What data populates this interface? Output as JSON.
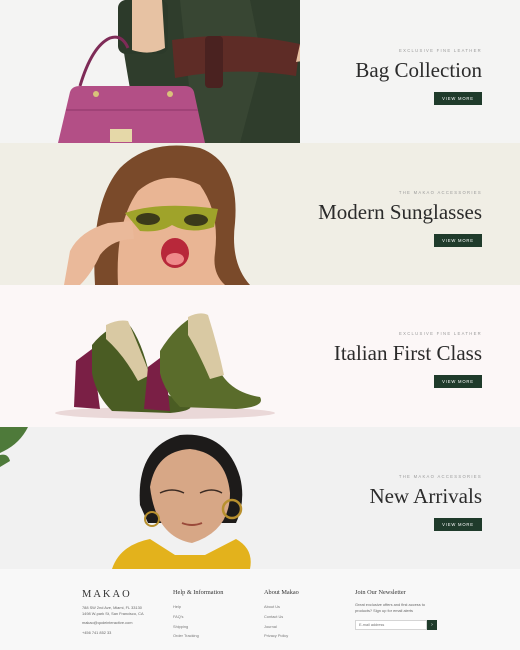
{
  "banners": [
    {
      "eyebrow": "Exclusive fine leather",
      "title": "Bag Collection",
      "button": "VIEW MORE"
    },
    {
      "eyebrow": "The Makao accessories",
      "title": "Modern Sunglasses",
      "button": "VIEW MORE"
    },
    {
      "eyebrow": "Exclusive fine leather",
      "title": "Italian First Class",
      "button": "VIEW MORE"
    },
    {
      "eyebrow": "The Makao accessories",
      "title": "New Arrivals",
      "button": "VIEW MORE"
    }
  ],
  "footer": {
    "logo": "MAKAO",
    "address_line1": "788 SW 2nd Ave, Miami, FL 33130",
    "address_line2": "1498 W-park St, San Francisco, CA",
    "email": "makao@qodeinteractive.com",
    "phone": "+456 741 852 33",
    "help": {
      "title": "Help & Information",
      "links": [
        "Help",
        "FAQ's",
        "Shipping",
        "Order Tracking"
      ]
    },
    "about": {
      "title": "About Makao",
      "links": [
        "About Us",
        "Contact Us",
        "Journal",
        "Privacy Policy"
      ]
    },
    "newsletter": {
      "title": "Join Our Newsletter",
      "text_line1": "Great exclusive offers and first access to",
      "text_line2": "products? Sign up for email alerts",
      "placeholder": "E-mail address",
      "button_icon": "arrow-right-icon"
    }
  },
  "colors": {
    "accent": "#1f3b2b",
    "bag": "#b34f86",
    "coat": "#2f3d2c",
    "belt": "#5e2c26",
    "sunglasses": "#9fa32a",
    "hair": "#7a4a2a",
    "shoe": "#4a5c23",
    "heel": "#7a1f45",
    "jacket": "#e3b21c"
  }
}
